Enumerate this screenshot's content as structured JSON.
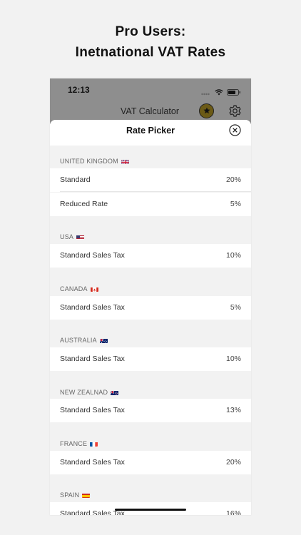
{
  "headline": {
    "line1": "Pro Users:",
    "line2": "Inetnational VAT Rates"
  },
  "status": {
    "time": "12:13"
  },
  "nav": {
    "title": "VAT Calculator"
  },
  "sheet": {
    "title": "Rate Picker"
  },
  "sections": [
    {
      "country": "UNITED KINGDOM",
      "flag": "uk-flag-icon",
      "rows": [
        {
          "label": "Standard",
          "value": "20%"
        },
        {
          "label": "Reduced Rate",
          "value": "5%"
        }
      ]
    },
    {
      "country": "USA",
      "flag": "us-flag-icon",
      "rows": [
        {
          "label": "Standard Sales Tax",
          "value": "10%"
        }
      ]
    },
    {
      "country": "CANADA",
      "flag": "canada-flag-icon",
      "rows": [
        {
          "label": "Standard Sales Tax",
          "value": "5%"
        }
      ]
    },
    {
      "country": "AUSTRALIA",
      "flag": "australia-flag-icon",
      "rows": [
        {
          "label": "Standard Sales Tax",
          "value": "10%"
        }
      ]
    },
    {
      "country": "NEW ZEALNAD",
      "flag": "new-zealand-flag-icon",
      "rows": [
        {
          "label": "Standard Sales Tax",
          "value": "13%"
        }
      ]
    },
    {
      "country": "FRANCE",
      "flag": "france-flag-icon",
      "rows": [
        {
          "label": "Standard Sales Tax",
          "value": "20%"
        }
      ]
    },
    {
      "country": "SPAIN",
      "flag": "spain-flag-icon",
      "rows": [
        {
          "label": "Standard Sales Tax",
          "value": "16%"
        }
      ]
    }
  ],
  "colors": {
    "nav_bg": "#8e8e8e",
    "star_bg": "#6b5a16",
    "list_bg": "#f2f2f2"
  }
}
